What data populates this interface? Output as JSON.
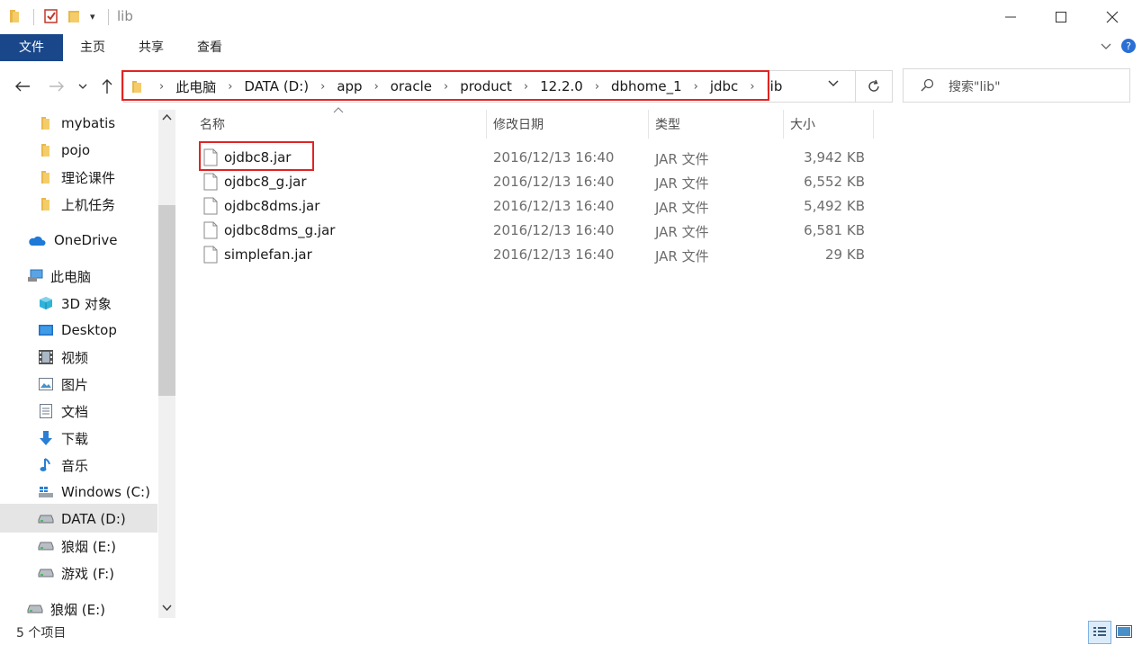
{
  "window": {
    "title": "lib",
    "title_separator": "|",
    "controls": [
      "minimize-icon",
      "maximize-icon",
      "close-icon"
    ]
  },
  "ribbon": {
    "tabs": [
      "文件",
      "主页",
      "共享",
      "查看"
    ],
    "active_tab": "文件"
  },
  "address": {
    "crumbs": [
      "此电脑",
      "DATA (D:)",
      "app",
      "oracle",
      "product",
      "12.2.0",
      "dbhome_1",
      "jdbc",
      "lib"
    ],
    "search_placeholder": "搜索\"lib\""
  },
  "nav": {
    "items": [
      {
        "label": "mybatis",
        "icon": "folder-icon"
      },
      {
        "label": "pojo",
        "icon": "folder-icon"
      },
      {
        "label": "理论课件",
        "icon": "folder-icon"
      },
      {
        "label": "上机任务",
        "icon": "folder-icon"
      },
      {
        "label": "OneDrive",
        "icon": "onedrive-cloud-icon"
      },
      {
        "label": "此电脑",
        "icon": "this-pc-icon"
      },
      {
        "label": "3D 对象",
        "icon": "3d-objects-icon"
      },
      {
        "label": "Desktop",
        "icon": "desktop-icon"
      },
      {
        "label": "视频",
        "icon": "videos-icon"
      },
      {
        "label": "图片",
        "icon": "pictures-icon"
      },
      {
        "label": "文档",
        "icon": "documents-icon"
      },
      {
        "label": "下载",
        "icon": "downloads-icon"
      },
      {
        "label": "音乐",
        "icon": "music-icon"
      },
      {
        "label": "Windows (C:)",
        "icon": "windows-drive-icon"
      },
      {
        "label": "DATA (D:)",
        "icon": "drive-icon"
      },
      {
        "label": "狼烟 (E:)",
        "icon": "drive-icon"
      },
      {
        "label": "游戏 (F:)",
        "icon": "drive-icon"
      },
      {
        "label": "狼烟 (E:)",
        "icon": "drive-icon"
      }
    ],
    "selected": "DATA (D:)"
  },
  "files": {
    "columns": [
      "名称",
      "修改日期",
      "类型",
      "大小"
    ],
    "rows": [
      {
        "name": "ojdbc8.jar",
        "date": "2016/12/13 16:40",
        "type": "JAR 文件",
        "size": "3,942 KB"
      },
      {
        "name": "ojdbc8_g.jar",
        "date": "2016/12/13 16:40",
        "type": "JAR 文件",
        "size": "6,552 KB"
      },
      {
        "name": "ojdbc8dms.jar",
        "date": "2016/12/13 16:40",
        "type": "JAR 文件",
        "size": "5,492 KB"
      },
      {
        "name": "ojdbc8dms_g.jar",
        "date": "2016/12/13 16:40",
        "type": "JAR 文件",
        "size": "6,581 KB"
      },
      {
        "name": "simplefan.jar",
        "date": "2016/12/13 16:40",
        "type": "JAR 文件",
        "size": "29 KB"
      }
    ]
  },
  "status": {
    "item_count": "5 个项目"
  },
  "colors": {
    "file_tab_bg": "#19478a",
    "highlight_red": "#e02424",
    "folder_yellow": "#e8b84a",
    "selection_gray": "#e5e5e5"
  }
}
